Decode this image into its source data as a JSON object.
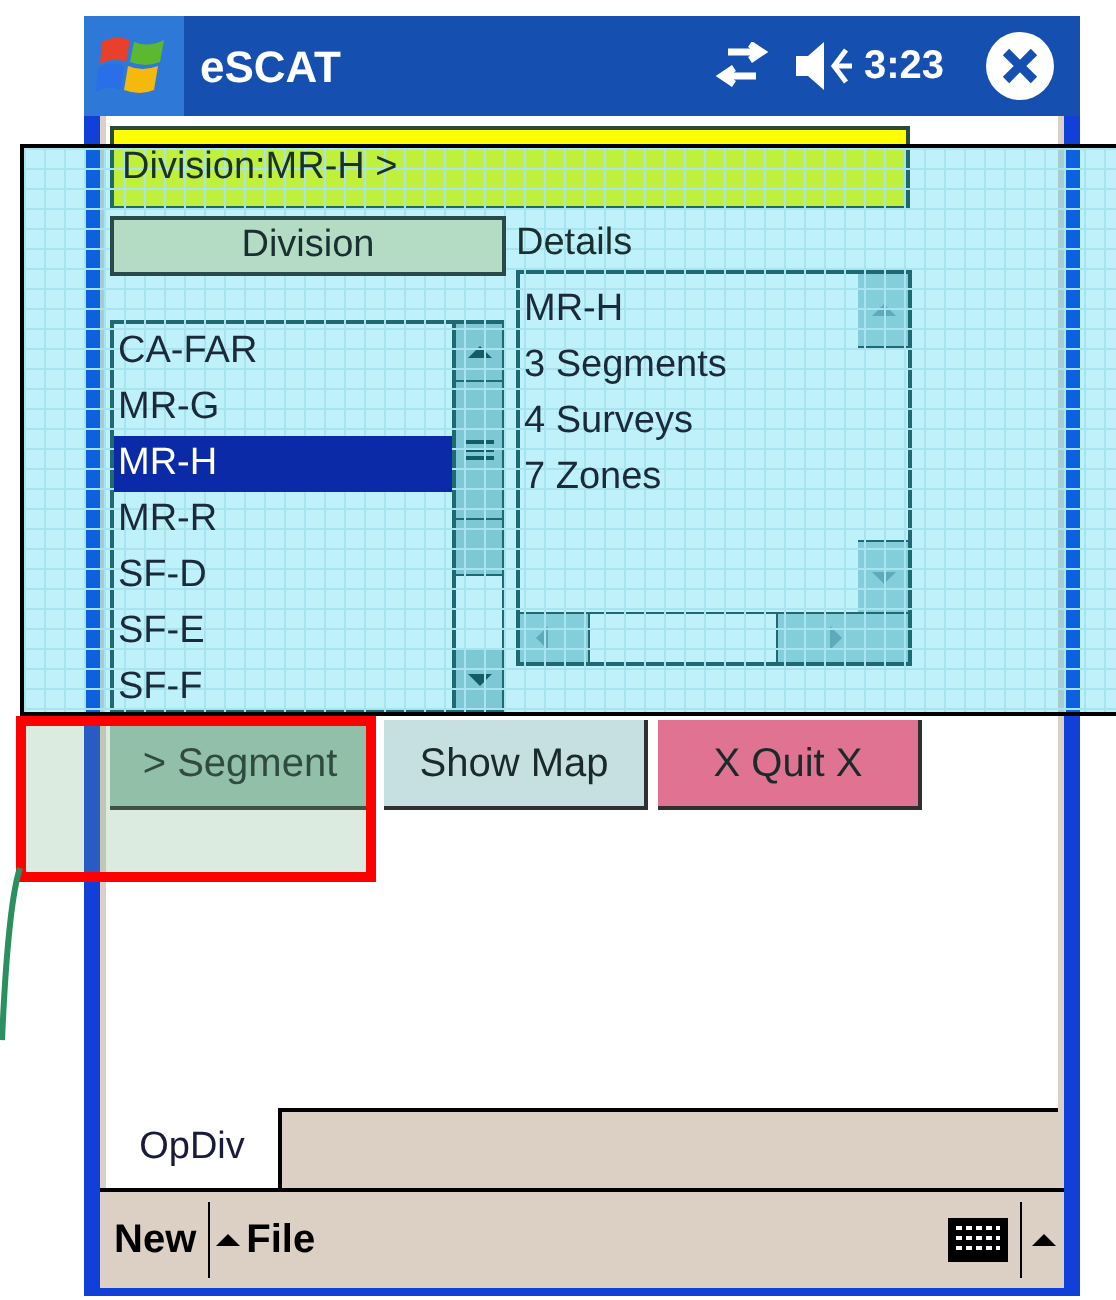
{
  "window": {
    "title": "eSCAT",
    "time": "3:23"
  },
  "breadcrumb": "Division:MR-H >",
  "division_header": "Division",
  "details_label": "Details",
  "divisions": [
    {
      "label": "CA-FAR",
      "selected": false
    },
    {
      "label": "MR-G",
      "selected": false
    },
    {
      "label": "MR-H",
      "selected": true
    },
    {
      "label": "MR-R",
      "selected": false
    },
    {
      "label": "SF-D",
      "selected": false
    },
    {
      "label": "SF-E",
      "selected": false
    },
    {
      "label": "SF-F",
      "selected": false
    }
  ],
  "details": [
    "MR-H",
    "3 Segments",
    "4 Surveys",
    "7 Zones"
  ],
  "buttons": [
    {
      "label": "> Segment",
      "kind": "primary"
    },
    {
      "label": "Show Map",
      "kind": "neutral"
    },
    {
      "label": "X Quit X",
      "kind": "danger"
    }
  ],
  "tabs": [
    {
      "label": "OpDiv",
      "selected": true
    }
  ],
  "menu": [
    {
      "label": "New",
      "kind": "plain"
    },
    {
      "label": "File",
      "kind": "caret"
    }
  ]
}
